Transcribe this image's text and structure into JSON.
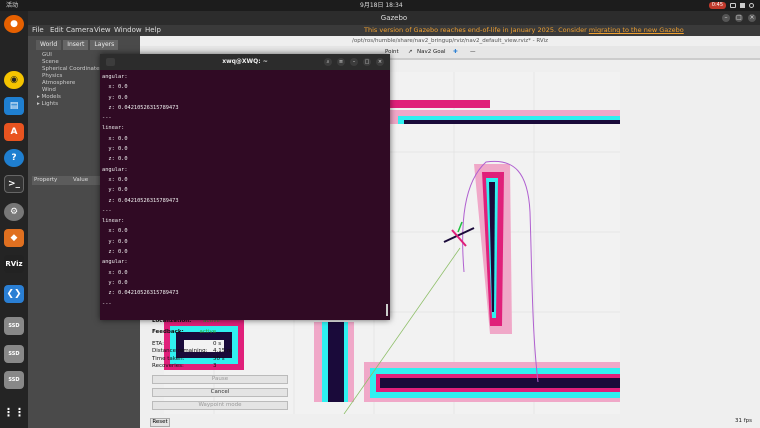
{
  "topbar": {
    "activities": "活动",
    "clock": "9月18日 18:34",
    "recording": "0:45"
  },
  "gazebo": {
    "title": "Gazebo",
    "menu": [
      "File",
      "Edit",
      "Camera",
      "View",
      "Window",
      "Help"
    ],
    "eol_text": "This version of Gazebo reaches end-of-life in January 2025. Consider ",
    "eol_link": "migrating to the new Gazebo",
    "tabs": [
      "World",
      "Insert",
      "Layers"
    ],
    "tree": [
      "GUI",
      "Scene",
      "Spherical Coordinates",
      "Physics",
      "Atmosphere",
      "Wind",
      "Models",
      "Lights"
    ],
    "prop_headers": [
      "Property",
      "Value"
    ]
  },
  "rviz": {
    "title": "/opt/ros/humble/share/nav2_bringup/rviz/nav2_default_view.rviz* - RViz",
    "toolbar": [
      "Point",
      "Nav2 Goal"
    ],
    "panel": {
      "localization_label": "Localization:",
      "localization_value": "active",
      "feedback_label": "Feedback:",
      "feedback_value": "active",
      "eta_label": "ETA:",
      "eta_value": "0 s",
      "distance_label": "Distance remaining:",
      "distance_value": "4.15 m",
      "time_label": "Time taken:",
      "time_value": "50 s",
      "recoveries_label": "Recoveries:",
      "recoveries_value": "3",
      "pause": "Pause",
      "cancel": "Cancel",
      "waypoint": "Waypoint mode"
    },
    "reset": "Reset",
    "fps": "31 fps",
    "colors": {
      "occupied": "#1a0a3a",
      "inflation_hot": "#e0207a",
      "inflation_cyan": "#30f0f0",
      "inflation_pink": "#f0a8c8",
      "plan": "#b060d0"
    }
  },
  "terminal": {
    "title": "xwq@XWQ: ~",
    "lines": [
      "angular:",
      "  x: 0.0",
      "  y: 0.0",
      "  z: 0.04210526315789473",
      "---",
      "linear:",
      "  x: 0.0",
      "  y: 0.0",
      "  z: 0.0",
      "angular:",
      "  x: 0.0",
      "  y: 0.0",
      "  z: 0.04210526315789473",
      "---",
      "linear:",
      "  x: 0.0",
      "  y: 0.0",
      "  z: 0.0",
      "angular:",
      "  x: 0.0",
      "  y: 0.0",
      "  z: 0.04210526315789473",
      "---"
    ]
  },
  "dock": [
    "firefox-icon",
    "music-icon",
    "writer-icon",
    "appstore-icon",
    "help-icon",
    "terminal-icon",
    "settings-icon",
    "gazebo-icon",
    "rviz-icon",
    "vscode-icon",
    "drive-icon",
    "drive-icon",
    "drive-icon",
    "apps-grid-icon"
  ]
}
